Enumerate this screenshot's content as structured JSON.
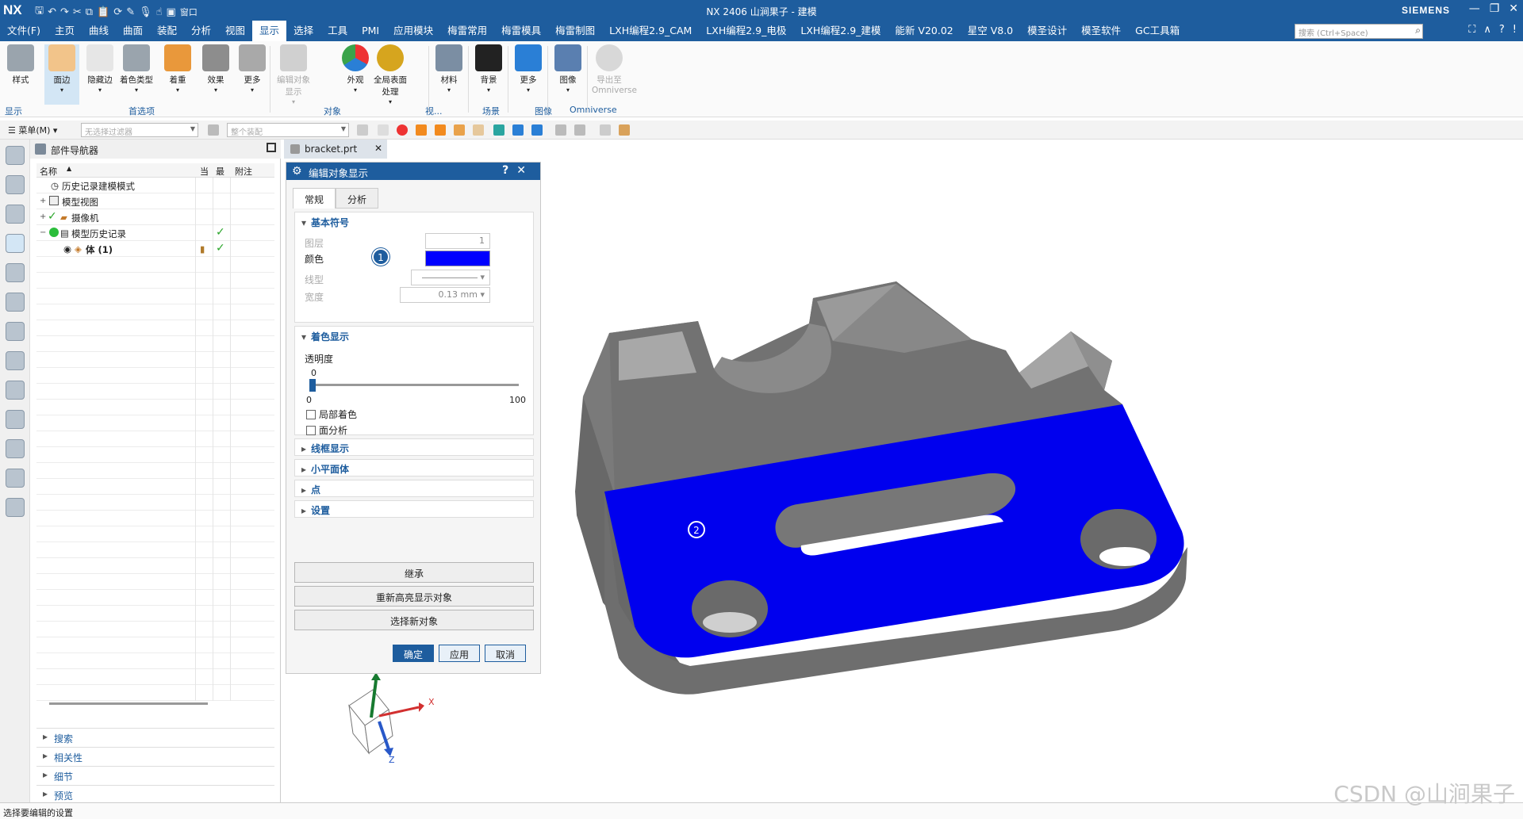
{
  "app": {
    "logo": "NX",
    "title": "NX 2406 山涧果子 - 建模",
    "brand": "SIEMENS",
    "window_menu": "窗口",
    "qat_icons": [
      "save-icon",
      "undo-icon",
      "redo-icon",
      "cut-icon",
      "copy-icon",
      "paste-icon",
      "repeat-icon",
      "pen-icon",
      "mic-icon",
      "touch-icon",
      "window-icon"
    ],
    "win_controls": [
      "minimize-icon",
      "restore-icon",
      "close-icon"
    ]
  },
  "menubar": {
    "items": [
      "文件(F)",
      "主页",
      "曲线",
      "曲面",
      "装配",
      "分析",
      "视图",
      "显示",
      "选择",
      "工具",
      "PMI",
      "应用模块",
      "梅雷常用",
      "梅雷模具",
      "梅雷制图",
      "LXH编程2.9_CAM",
      "LXH编程2.9_电极",
      "LXH编程2.9_建模",
      "能新 V20.02",
      "星空 V8.0",
      "模圣设计",
      "模圣软件",
      "GC工具箱"
    ],
    "active_index": 7,
    "search_placeholder": "搜索 (Ctrl+Space)",
    "right_icons": [
      "fullscreen-icon",
      "collapse-ribbon-icon",
      "help-icon",
      "info-icon"
    ]
  },
  "ribbon": {
    "buttons": [
      {
        "label": "样式",
        "name": "style"
      },
      {
        "label": "面边",
        "name": "face-edges"
      },
      {
        "label": "隐藏边",
        "name": "hidden-edges"
      },
      {
        "label": "着色类型",
        "name": "shading-type"
      },
      {
        "label": "着重",
        "name": "emphasis"
      },
      {
        "label": "效果",
        "name": "effects"
      },
      {
        "label": "更多",
        "name": "more-1"
      },
      {
        "label": "编辑对象显示",
        "name": "edit-object-display"
      },
      {
        "label": "外观",
        "name": "appearance"
      },
      {
        "label": "全局表面处理",
        "name": "global-surface"
      },
      {
        "label": "材料",
        "name": "material"
      },
      {
        "label": "背景",
        "name": "background"
      },
      {
        "label": "更多",
        "name": "more-2"
      },
      {
        "label": "图像",
        "name": "image"
      },
      {
        "label": "导出至 Omniverse",
        "name": "export-omniverse"
      }
    ],
    "groups": [
      "显示",
      "首选项",
      "对象",
      "视...",
      "场景",
      "图像",
      "Omniverse"
    ]
  },
  "toolbar2": {
    "menu": "菜单(M)",
    "filter_placeholder": "无选择过滤器",
    "assembly_placeholder": "整个装配"
  },
  "leftbar": {
    "icons": [
      "settings-icon",
      "part-icon",
      "assembly-icon",
      "navigator-icon",
      "constraints-icon",
      "reuse-icon",
      "hd3d-icon",
      "info-icon",
      "web-icon",
      "history-icon",
      "tools-icon",
      "roles-icon",
      "layout-icon"
    ]
  },
  "nav": {
    "title": "部件导航器",
    "columns": [
      "名称",
      "当",
      "最",
      "附注"
    ],
    "rows": [
      {
        "label": "历史记录建模模式",
        "indent": 0,
        "expand": ""
      },
      {
        "label": "模型视图",
        "indent": 0,
        "expand": "+"
      },
      {
        "label": "摄像机",
        "indent": 0,
        "expand": "+"
      },
      {
        "label": "模型历史记录",
        "indent": 0,
        "expand": "-"
      },
      {
        "label": "体 (1)",
        "indent": 1,
        "expand": ""
      }
    ],
    "sections": [
      "搜索",
      "相关性",
      "细节",
      "预览"
    ]
  },
  "tab": {
    "file": "bracket.prt"
  },
  "dialog": {
    "title": "编辑对象显示",
    "tabs": [
      "常规",
      "分析"
    ],
    "basic": {
      "header": "基本符号",
      "layer_label": "图层",
      "layer_value": "1",
      "color_label": "颜色",
      "color": "#0000ff",
      "linetype_label": "线型",
      "width_label": "宽度",
      "width_value": "0.13 mm"
    },
    "shading": {
      "header": "着色显示",
      "transparency_label": "透明度",
      "transparency_value": "0",
      "min": "0",
      "max": "100",
      "local_shading": "局部着色",
      "face_analysis": "面分析"
    },
    "collapsed": [
      "线框显示",
      "小平面体",
      "点",
      "设置"
    ],
    "actions": [
      "继承",
      "重新高亮显示对象",
      "选择新对象"
    ],
    "buttons": {
      "ok": "确定",
      "apply": "应用",
      "cancel": "取消"
    }
  },
  "annotations": {
    "one": "1",
    "two": "2"
  },
  "triad": {
    "x": "X",
    "z": "Z"
  },
  "status": "选择要编辑的设置",
  "watermark": "CSDN @山涧果子"
}
